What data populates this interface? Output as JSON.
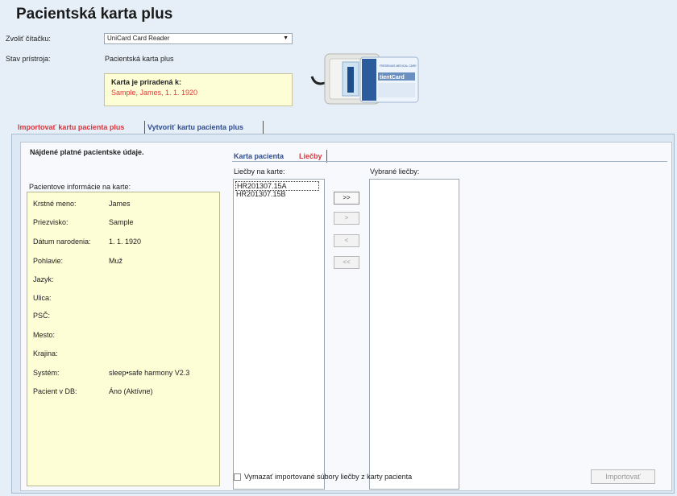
{
  "title": "Pacientská karta plus",
  "reader": {
    "label": "Zvoliť čítačku:",
    "selected": "UniCard Card Reader"
  },
  "device_state": {
    "label": "Stav prístroja:",
    "value": "Pacientská karta plus"
  },
  "assigned": {
    "title": "Karta je priradená k:",
    "value": "Sample, James, 1. 1. 1920"
  },
  "device_card": {
    "brand": "FRESENIUS MEDICAL CARE",
    "card_text": "tientCard"
  },
  "tabs": {
    "import": "Importovať kartu pacienta plus",
    "create": "Vytvoriť kartu pacienta plus"
  },
  "found_text": "Nájdené platné pacientske údaje.",
  "patient_info_label": "Pacientove informácie na karte:",
  "patient": [
    {
      "key": "Krstné meno:",
      "value": "James"
    },
    {
      "key": "Priezvisko:",
      "value": "Sample"
    },
    {
      "key": "Dátum narodenia:",
      "value": "1. 1. 1920"
    },
    {
      "key": "Pohlavie:",
      "value": "Muž"
    },
    {
      "key": "Jazyk:",
      "value": ""
    },
    {
      "key": "Ulica:",
      "value": ""
    },
    {
      "key": "PSČ:",
      "value": ""
    },
    {
      "key": "Mesto:",
      "value": ""
    },
    {
      "key": "Krajina:",
      "value": ""
    },
    {
      "key": "Systém:",
      "value": "sleep•safe harmony V2.3"
    },
    {
      "key": "Pacient v DB:",
      "value": "Áno (Aktívne)"
    }
  ],
  "subtabs": {
    "card": "Karta pacienta",
    "therapies": "Liečby"
  },
  "available": {
    "label": "Liečby na karte:",
    "items": [
      "HR201307.15A",
      "HR201307.15B"
    ]
  },
  "selected": {
    "label": "Vybrané liečby:",
    "items": []
  },
  "move_buttons": {
    "all_right": ">>",
    "right": ">",
    "left": "<",
    "all_left": "<<"
  },
  "delete_files_label": "Vymazať importované súbory liečby z karty pacienta",
  "import_button": "Importovať"
}
